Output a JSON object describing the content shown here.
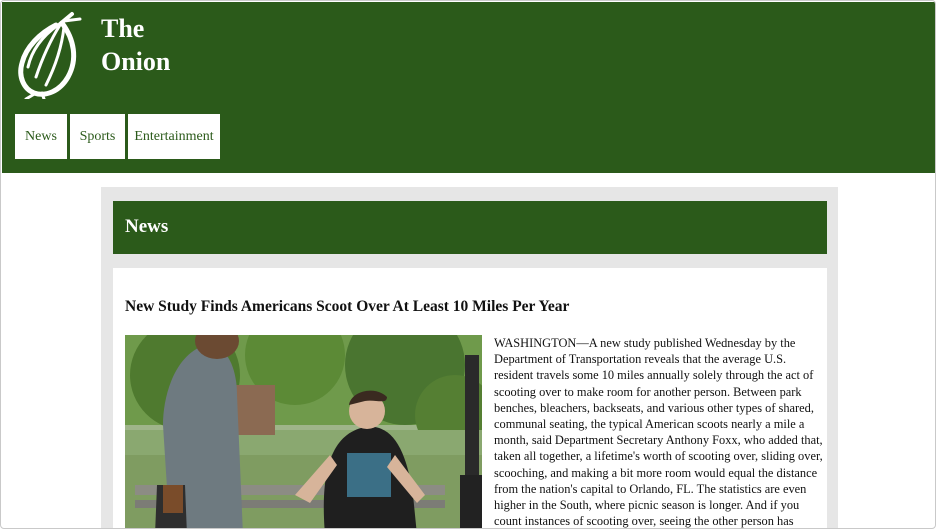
{
  "site": {
    "title_line1": "The",
    "title_line2": "Onion"
  },
  "nav": {
    "items": [
      "News",
      "Sports",
      "Entertainment"
    ]
  },
  "section": {
    "title": "News"
  },
  "article": {
    "headline": "New Study Finds Americans Scoot Over At Least 10 Miles Per Year",
    "body": "WASHINGTON—A new study published Wednesday by the Department of Transportation reveals that the average U.S. resident travels some 10 miles annually solely through the act of scooting over to make room for another person. Between park benches, bleachers, backseats, and various other types of shared, communal seating, the typical American scoots nearly a mile a month, said Department Secretary Anthony Foxx, who added that, taken all together, a lifetime's worth of scooting over, sliding over, scooching, and making a bit more room would equal the distance from the nation's capital to Orlando, FL. The statistics are even higher in the South, where picnic season is longer. And if you count instances of scooting over, seeing the other person has"
  },
  "colors": {
    "brand_green": "#2b5a1a",
    "panel_gray": "#e6e6e6"
  },
  "icons": {
    "logo": "onion-logo-icon"
  }
}
